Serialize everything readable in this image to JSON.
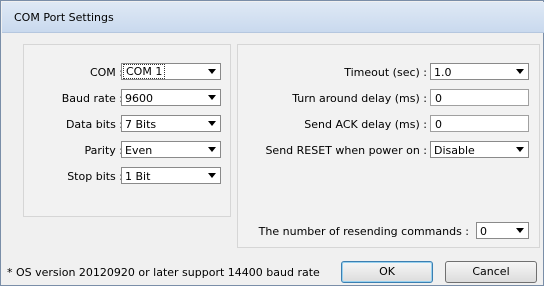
{
  "window": {
    "title": "COM Port Settings"
  },
  "left": {
    "com": {
      "label": "COM :",
      "value": "COM 1"
    },
    "baud": {
      "label": "Baud rate :",
      "value": "9600"
    },
    "data_bits": {
      "label": "Data bits :",
      "value": "7 Bits"
    },
    "parity": {
      "label": "Parity :",
      "value": "Even"
    },
    "stop_bits": {
      "label": "Stop bits :",
      "value": "1 Bit"
    }
  },
  "right": {
    "timeout": {
      "label": "Timeout (sec) :",
      "value": "1.0"
    },
    "turnaround": {
      "label": "Turn around delay (ms) :",
      "value": "0"
    },
    "ack": {
      "label": "Send ACK delay (ms) :",
      "value": "0"
    },
    "reset": {
      "label": "Send RESET when power on :",
      "value": "Disable"
    },
    "resend": {
      "label": "The number of resending commands :",
      "value": "0"
    }
  },
  "footer": {
    "note": "* OS version 20120920 or later support 14400 baud rate",
    "ok": "OK",
    "cancel": "Cancel"
  }
}
